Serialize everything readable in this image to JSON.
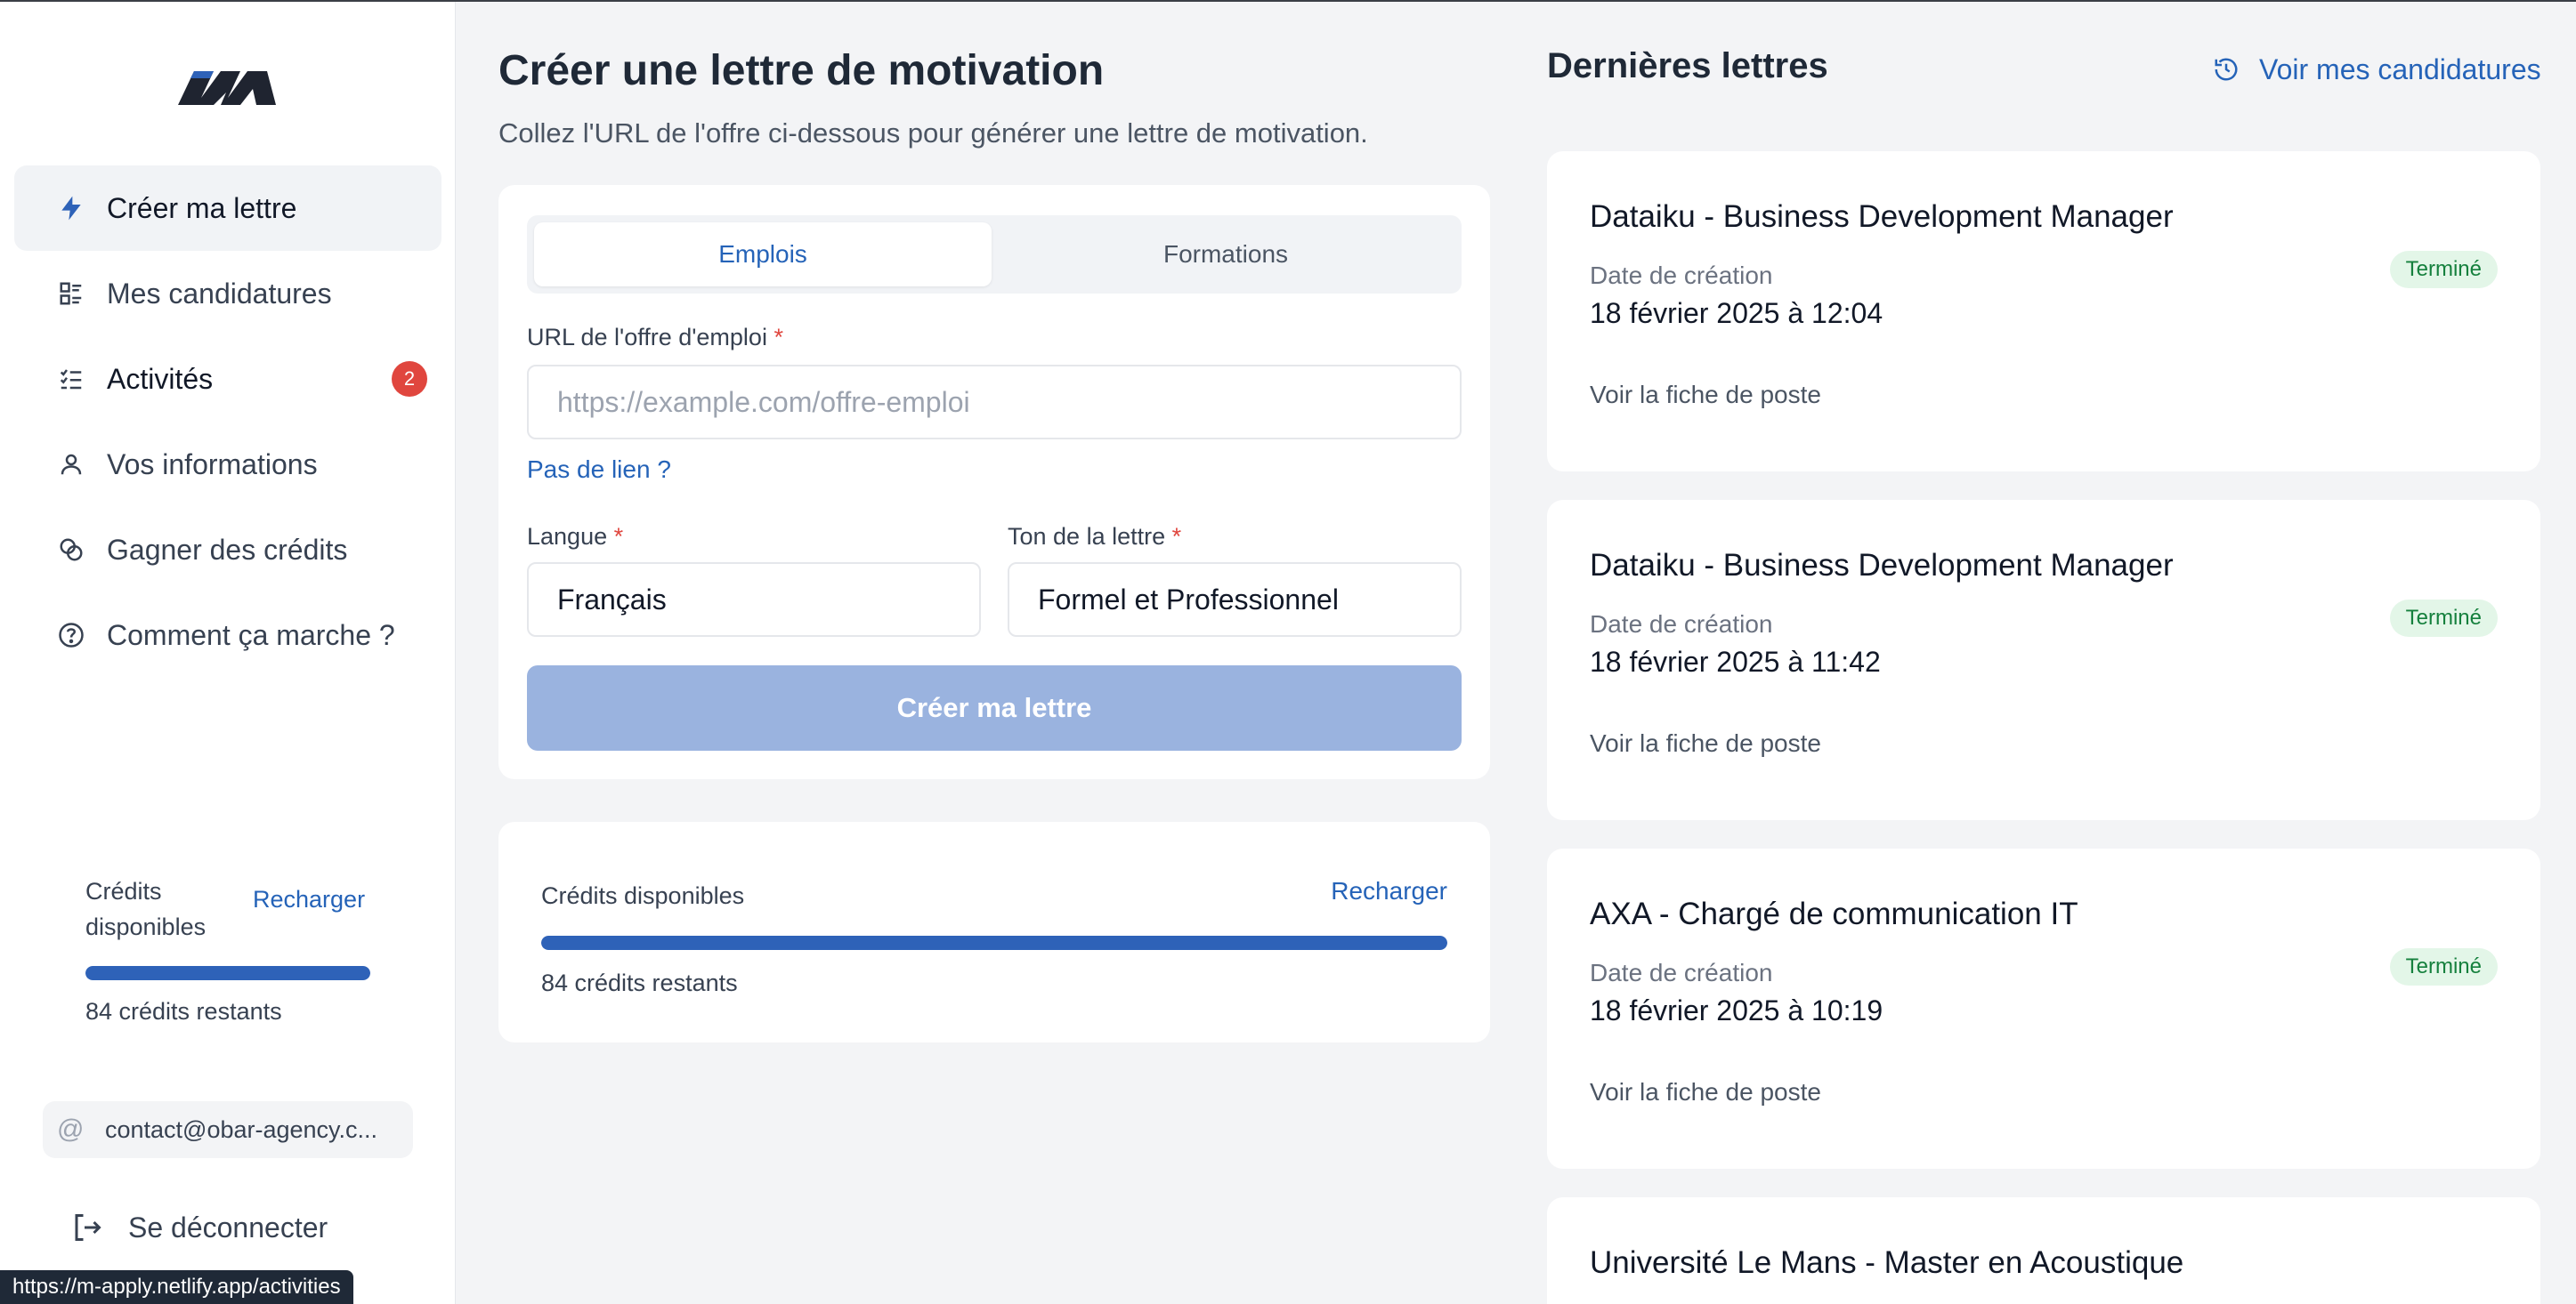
{
  "sidebar": {
    "nav": [
      {
        "label": "Créer ma lettre",
        "icon": "bolt-icon",
        "active": true
      },
      {
        "label": "Mes candidatures",
        "icon": "list-icon"
      },
      {
        "label": "Activités",
        "icon": "checklist-icon",
        "badge": "2"
      },
      {
        "label": "Vos informations",
        "icon": "user-icon"
      },
      {
        "label": "Gagner des crédits",
        "icon": "coins-icon"
      },
      {
        "label": "Comment ça marche ?",
        "icon": "help-circle-icon"
      }
    ],
    "credits": {
      "label": "Crédits disponibles",
      "recharge": "Recharger",
      "remaining": "84 crédits restants",
      "progress": 1.0
    },
    "email": "contact@obar-agency.c...",
    "logout": "Se déconnecter"
  },
  "status_url": "https://m-apply.netlify.app/activities",
  "main": {
    "title": "Créer une lettre de motivation",
    "subtitle": "Collez l'URL de l'offre ci-dessous pour générer une lettre de motivation.",
    "tabs": [
      {
        "label": "Emplois",
        "active": true
      },
      {
        "label": "Formations",
        "active": false
      }
    ],
    "url_label": "URL de l'offre d'emploi",
    "required_mark": "*",
    "url_placeholder": "https://example.com/offre-emploi",
    "url_value": "",
    "no_link": "Pas de lien ?",
    "language_label": "Langue",
    "language_value": "Français",
    "tone_label": "Ton de la lettre",
    "tone_value": "Formel et Professionnel",
    "create_button": "Créer ma lettre",
    "credits": {
      "label": "Crédits disponibles",
      "recharge": "Recharger",
      "remaining": "84 crédits restants",
      "progress": 1.0
    }
  },
  "recent": {
    "title": "Dernières lettres",
    "view_all": "Voir mes candidatures",
    "date_label": "Date de création",
    "view_job": "Voir la fiche de poste",
    "letters": [
      {
        "title": "Dataiku - Business Development Manager",
        "date": "18 février 2025 à 12:04",
        "status": "Terminé"
      },
      {
        "title": "Dataiku - Business Development Manager",
        "date": "18 février 2025 à 11:42",
        "status": "Terminé"
      },
      {
        "title": "AXA - Chargé de communication IT",
        "date": "18 février 2025 à 10:19",
        "status": "Terminé"
      },
      {
        "title": "Université Le Mans - Master en Acoustique",
        "date": "",
        "status": ""
      }
    ]
  },
  "colors": {
    "accent": "#2563b8",
    "badge": "#e0463e",
    "status_bg": "#e3f6e8",
    "status_text": "#15803d",
    "button_disabled": "#9ab3df"
  }
}
